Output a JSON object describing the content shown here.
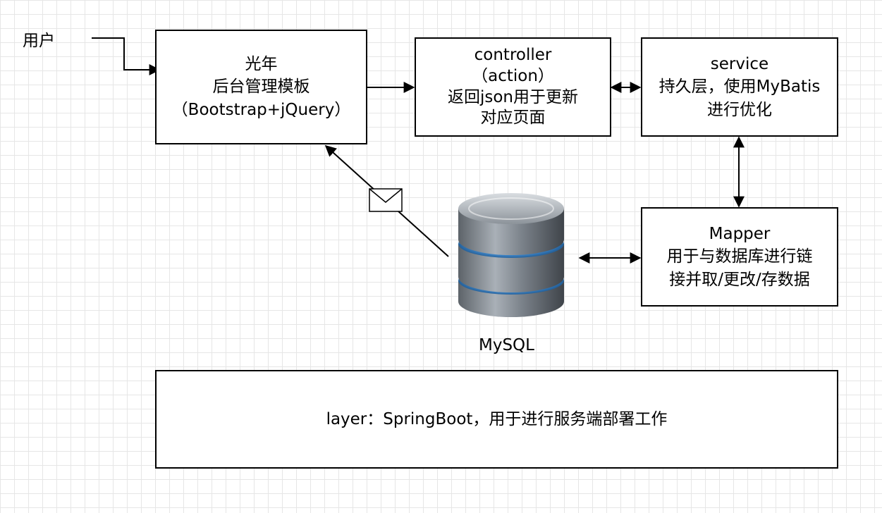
{
  "nodes": {
    "user": {
      "label": "用户"
    },
    "frontend": {
      "lines": [
        "光年",
        "后台管理模板",
        "（Bootstrap+jQuery）"
      ]
    },
    "controller": {
      "lines": [
        "controller",
        "（action）",
        "返回json用于更新",
        "对应页面"
      ]
    },
    "service": {
      "lines": [
        "service",
        "持久层，使用MyBatis",
        "进行优化"
      ]
    },
    "mapper": {
      "lines": [
        "Mapper",
        "用于与数据库进行链",
        "接并取/更改/存数据"
      ]
    },
    "database": {
      "label": "MySQL",
      "icon": "database-cylinder-icon"
    },
    "layer": {
      "label": "layer：SpringBoot，用于进行服务端部署工作"
    }
  },
  "icons": {
    "message": "envelope-icon"
  },
  "colors": {
    "database_glow": "#4aa8ff",
    "database_body": "#7b828a",
    "grid": "#e6e6e6"
  }
}
